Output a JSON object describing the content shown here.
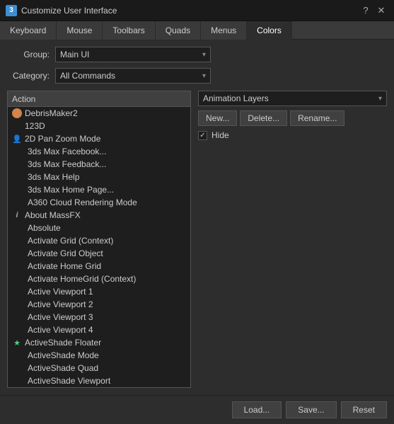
{
  "titleBar": {
    "icon": "3",
    "title": "Customize User Interface",
    "helpBtn": "?",
    "closeBtn": "✕"
  },
  "tabs": [
    {
      "label": "Keyboard",
      "active": false
    },
    {
      "label": "Mouse",
      "active": false
    },
    {
      "label": "Toolbars",
      "active": false
    },
    {
      "label": "Quads",
      "active": false
    },
    {
      "label": "Menus",
      "active": false
    },
    {
      "label": "Colors",
      "active": true
    }
  ],
  "groupLabel": "Group:",
  "groupValue": "Main UI",
  "categoryLabel": "Category:",
  "categoryValue": "All Commands",
  "listHeader": "Action",
  "listItems": [
    {
      "text": "DebrisMaker2",
      "icon": "orange-dot",
      "indent": false
    },
    {
      "text": "123D",
      "icon": null,
      "indent": false
    },
    {
      "text": "2D Pan Zoom Mode",
      "icon": "person",
      "indent": false
    },
    {
      "text": "3ds Max Facebook...",
      "icon": null,
      "indent": true
    },
    {
      "text": "3ds Max Feedback...",
      "icon": null,
      "indent": true
    },
    {
      "text": "3ds Max Help",
      "icon": null,
      "indent": true
    },
    {
      "text": "3ds Max Home Page...",
      "icon": null,
      "indent": true
    },
    {
      "text": "A360 Cloud Rendering Mode",
      "icon": null,
      "indent": true
    },
    {
      "text": "About MassFX",
      "icon": "info",
      "indent": false
    },
    {
      "text": "Absolute",
      "icon": null,
      "indent": true
    },
    {
      "text": "Activate Grid (Context)",
      "icon": null,
      "indent": true
    },
    {
      "text": "Activate Grid Object",
      "icon": null,
      "indent": true
    },
    {
      "text": "Activate Home Grid",
      "icon": null,
      "indent": true
    },
    {
      "text": "Activate HomeGrid (Context)",
      "icon": null,
      "indent": true
    },
    {
      "text": "Active Viewport 1",
      "icon": null,
      "indent": true
    },
    {
      "text": "Active Viewport 2",
      "icon": null,
      "indent": true
    },
    {
      "text": "Active Viewport 3",
      "icon": null,
      "indent": true
    },
    {
      "text": "Active Viewport 4",
      "icon": null,
      "indent": true
    },
    {
      "text": "ActiveShade Floater",
      "icon": "green-star",
      "indent": false
    },
    {
      "text": "ActiveShade Mode",
      "icon": null,
      "indent": true
    },
    {
      "text": "ActiveShade Quad",
      "icon": null,
      "indent": true
    },
    {
      "text": "ActiveShade Viewport",
      "icon": null,
      "indent": true
    }
  ],
  "rightPanel": {
    "animLayersLabel": "Animation Layers",
    "newBtn": "New...",
    "deleteBtn": "Delete...",
    "renameBtn": "Rename...",
    "hideCheckbox": true,
    "hideLabel": "Hide"
  },
  "bottomBar": {
    "loadBtn": "Load...",
    "saveBtn": "Save...",
    "resetBtn": "Reset"
  }
}
